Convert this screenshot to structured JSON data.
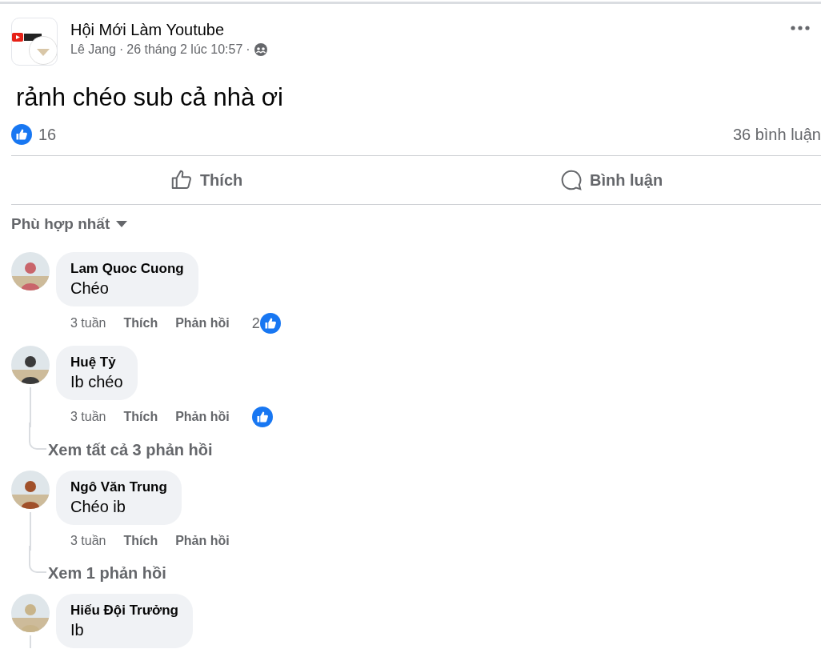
{
  "post": {
    "group": "Hội Mới Làm Youtube",
    "author": "Lê Jang",
    "time": "26 tháng 2 lúc 10:57",
    "separators": [
      "·",
      "·"
    ],
    "text": "rảnh chéo sub cả nhà ơi",
    "likes": "16",
    "comments_count": "36 bình luận"
  },
  "actions": [
    {
      "kind": "like",
      "label": "Thích"
    },
    {
      "kind": "comment",
      "label": "Bình luận"
    }
  ],
  "sort": {
    "label": "Phù hợp nhất"
  },
  "comments": [
    {
      "name": "Lam Quoc Cuong",
      "text": "Chéo",
      "time": "3 tuần",
      "like": "Thích",
      "reply": "Phản hồi",
      "reaction_count": "2",
      "reacted": true
    },
    {
      "name": "Huệ Tỷ",
      "text": "Ib chéo",
      "time": "3 tuần",
      "like": "Thích",
      "reply": "Phản hồi",
      "reacted": true,
      "replies_link": "Xem tất cả 3 phản hồi"
    },
    {
      "name": "Ngô Văn Trung",
      "text": "Chéo ib",
      "time": "3 tuần",
      "like": "Thích",
      "reply": "Phản hồi",
      "reacted": false,
      "replies_link": "Xem 1 phản hồi"
    },
    {
      "name": "Hiếu Đội Trưởng",
      "text": "Ib",
      "thread": true
    }
  ]
}
